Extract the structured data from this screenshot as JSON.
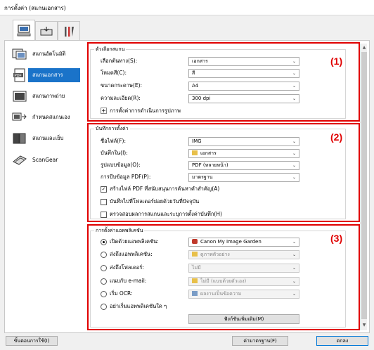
{
  "window": {
    "title": "การตั้งค่า (สแกนเอกสาร)"
  },
  "tabs": [
    {
      "name": "scan-from-computer",
      "icon": "computer-scan-icon"
    },
    {
      "name": "scan-from-panel",
      "icon": "scanner-panel-icon"
    },
    {
      "name": "general-settings",
      "icon": "tools-icon"
    }
  ],
  "sidebar": {
    "items": [
      {
        "label": "สแกนอัตโนมัติ",
        "icon": "auto-scan-icon"
      },
      {
        "label": "สแกนเอกสาร",
        "icon": "pdf-document-icon",
        "selected": true
      },
      {
        "label": "สแกนภาพถ่าย",
        "icon": "photo-icon"
      },
      {
        "label": "กำหนดสแกนเอง",
        "icon": "custom-scan-icon"
      },
      {
        "label": "สแกนและเย็บ",
        "icon": "stitch-icon"
      },
      {
        "label": "ScanGear",
        "icon": "scangear-icon"
      }
    ]
  },
  "section1": {
    "number": "(1)",
    "title": "ตัวเลือกสแกน",
    "rows": [
      {
        "label": "เลือกต้นทาง(S):",
        "value": "เอกสาร"
      },
      {
        "label": "โหมดสี(C):",
        "value": "สี"
      },
      {
        "label": "ขนาดกระดาษ(E):",
        "value": "A4"
      },
      {
        "label": "ความละเอียด(R):",
        "value": "300 dpi"
      }
    ],
    "expand_label": "การตั้งค่าการดำเนินการรูปภาพ"
  },
  "section2": {
    "number": "(2)",
    "title": "บันทึกการตั้งค่า",
    "rows": [
      {
        "label": "ชื่อไฟล์(F):",
        "value": "IMG",
        "type": "text"
      },
      {
        "label": "บันทึกใน(I):",
        "value": "เอกสาร",
        "type": "folder"
      },
      {
        "label": "รูปแบบข้อมูล(O):",
        "value": "PDF (หลายหน้า)",
        "type": "select"
      },
      {
        "label": "การบีบข้อมูล PDF(P):",
        "value": "มาตรฐาน",
        "type": "select"
      }
    ],
    "checkboxes": [
      {
        "label": "สร้างไฟล์ PDF ที่สนับสนุนการค้นหาคำสำคัญ(A)",
        "checked": true
      },
      {
        "label": "บันทึกไปที่โฟลเดอร์ย่อยด้วยวันที่ปัจจุบัน",
        "checked": false
      },
      {
        "label": "ตรวจสอบผลการสแกนและระบุการตั้งค่าบันทึก(H)",
        "checked": false
      }
    ]
  },
  "section3": {
    "number": "(3)",
    "title": "การตั้งค่าแอพพลิเคชัน",
    "rows": [
      {
        "label": "เปิดด้วยแอพพลิเคชัน:",
        "value": "Canon My Image Garden",
        "selected": true,
        "disabled": false
      },
      {
        "label": "ส่งถึงแอพพลิเคชัน:",
        "value": "ดูภาพตัวอย่าง",
        "selected": false,
        "disabled": true
      },
      {
        "label": "ส่งถึงโฟลเดอร์:",
        "value": "ไม่มี",
        "selected": false,
        "disabled": true
      },
      {
        "label": "แนบกับ e-mail:",
        "value": "ไม่มี (แนบด้วยตัวเอง)",
        "selected": false,
        "disabled": true
      },
      {
        "label": "เริ่ม OCR:",
        "value": "ผลงานเป็นข้อความ",
        "selected": false,
        "disabled": true
      },
      {
        "label": "อย่าเริ่มแอพพลิเคชันใด ๆ",
        "selected": false
      }
    ],
    "more_functions_label": "ฟังก์ชันเพิ่มเติม(M)"
  },
  "footer": {
    "instructions_label": "ขั้นตอนการใช้(I)",
    "defaults_label": "ค่ามาตรฐาน(F)",
    "ok_label": "ตกลง"
  }
}
